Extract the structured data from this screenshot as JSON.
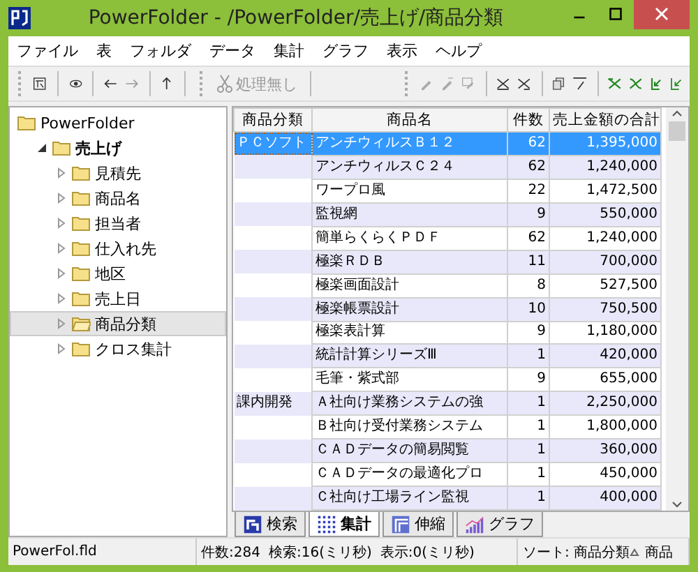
{
  "window": {
    "title": "PowerFolder - /PowerFolder/売上げ/商品分類"
  },
  "menu": [
    "ファイル",
    "表",
    "フォルダ",
    "データ",
    "集計",
    "グラフ",
    "表示",
    "ヘルプ"
  ],
  "toolbar": {
    "process_button": {
      "label": "処理無し",
      "disabled": true
    }
  },
  "tree": [
    {
      "label": "PowerFolder",
      "selected": false,
      "children": [
        {
          "label": "売上げ",
          "selected": false,
          "expanded": true,
          "children": [
            {
              "label": "見積先",
              "selected": false,
              "expanded": false
            },
            {
              "label": "商品名",
              "selected": false,
              "expanded": false
            },
            {
              "label": "担当者",
              "selected": false,
              "expanded": false
            },
            {
              "label": "仕入れ先",
              "selected": false,
              "expanded": false
            },
            {
              "label": "地区",
              "selected": false,
              "expanded": false
            },
            {
              "label": "売上日",
              "selected": false,
              "expanded": false
            },
            {
              "label": "商品分類",
              "selected": true,
              "expanded": false
            },
            {
              "label": "クロス集計",
              "selected": false,
              "expanded": false
            }
          ]
        }
      ]
    }
  ],
  "table": {
    "columns": [
      "商品分類",
      "商品名",
      "件数",
      "売上金額の合計"
    ],
    "rows": [
      {
        "category": "ＰＣソフト",
        "name": "アンチウィルスＢ１２",
        "count": "62",
        "total": "1,395,000",
        "selected": true
      },
      {
        "category": "",
        "name": "アンチウィルスＣ２４",
        "count": "62",
        "total": "1,240,000",
        "selected": false
      },
      {
        "category": "",
        "name": "ワープロ風",
        "count": "22",
        "total": "1,472,500",
        "selected": false
      },
      {
        "category": "",
        "name": "監視網",
        "count": "9",
        "total": "550,000",
        "selected": false
      },
      {
        "category": "",
        "name": "簡単らくらくＰＤＦ",
        "count": "62",
        "total": "1,240,000",
        "selected": false
      },
      {
        "category": "",
        "name": "極楽ＲＤＢ",
        "count": "11",
        "total": "700,000",
        "selected": false
      },
      {
        "category": "",
        "name": "極楽画面設計",
        "count": "8",
        "total": "527,500",
        "selected": false
      },
      {
        "category": "",
        "name": "極楽帳票設計",
        "count": "10",
        "total": "750,500",
        "selected": false
      },
      {
        "category": "",
        "name": "極楽表計算",
        "count": "9",
        "total": "1,180,000",
        "selected": false
      },
      {
        "category": "",
        "name": "統計計算シリーズⅢ",
        "count": "1",
        "total": "420,000",
        "selected": false
      },
      {
        "category": "",
        "name": "毛筆・紫式部",
        "count": "9",
        "total": "655,000",
        "selected": false
      },
      {
        "category": "課内開発",
        "name": "Ａ社向け業務システムの強",
        "count": "1",
        "total": "2,250,000",
        "selected": false
      },
      {
        "category": "",
        "name": "Ｂ社向け受付業務システム",
        "count": "1",
        "total": "1,800,000",
        "selected": false
      },
      {
        "category": "",
        "name": "ＣＡＤデータの簡易閲覧",
        "count": "1",
        "total": "360,000",
        "selected": false
      },
      {
        "category": "",
        "name": "ＣＡＤデータの最適化プロ",
        "count": "1",
        "total": "450,000",
        "selected": false
      },
      {
        "category": "",
        "name": "Ｃ社向け工場ライン監視",
        "count": "1",
        "total": "400,000",
        "selected": false
      }
    ]
  },
  "view_tabs": [
    {
      "label": "検索",
      "kind": "search",
      "selected": false
    },
    {
      "label": "集計",
      "kind": "grid",
      "selected": true
    },
    {
      "label": "伸縮",
      "kind": "stretch",
      "selected": false
    },
    {
      "label": "グラフ",
      "kind": "chart",
      "selected": false
    }
  ],
  "status_bar": {
    "file": "PowerFol.fld",
    "count": "件数:284",
    "search_time": "検索:16(ミリ秒)",
    "display_time": "表示:0(ミリ秒)",
    "sort": "ソート: 商品分類",
    "sort_second": "商品"
  }
}
